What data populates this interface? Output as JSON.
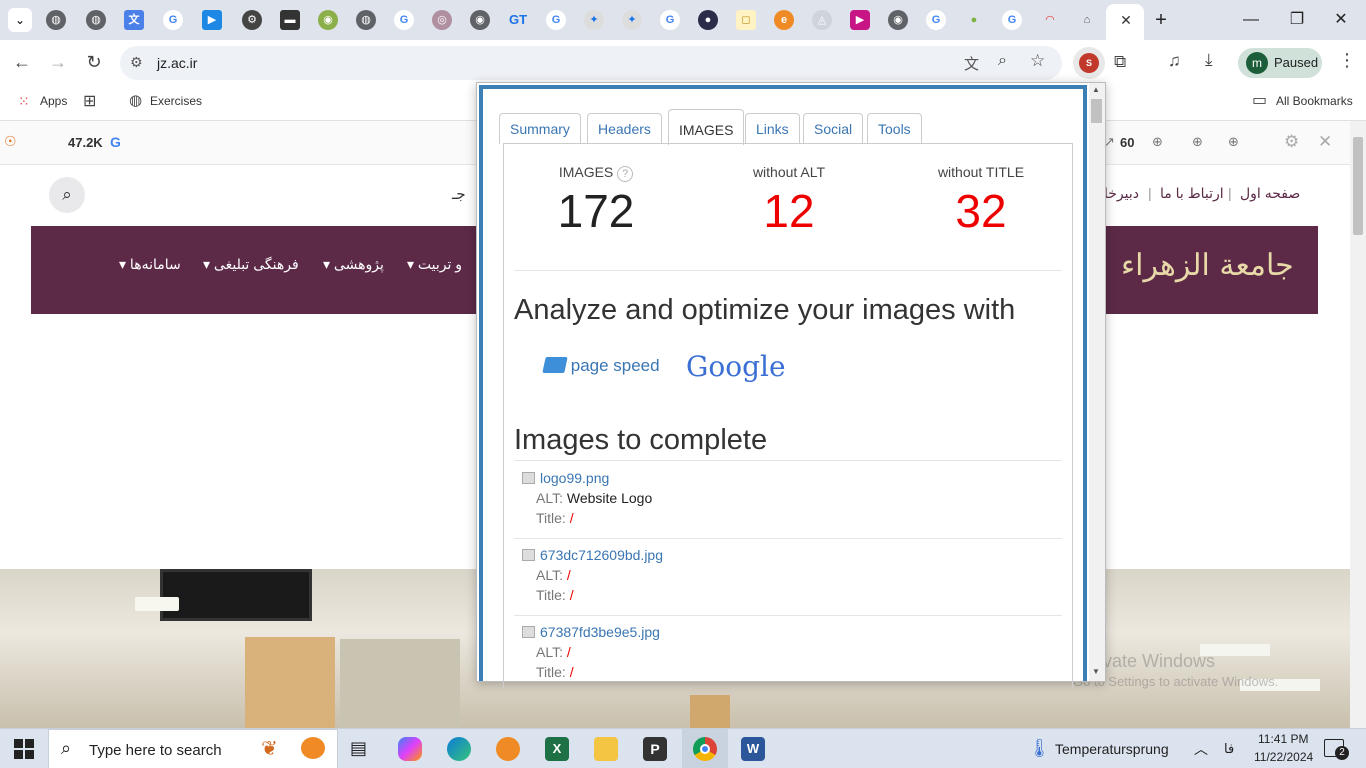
{
  "browser": {
    "address": "jz.ac.ir",
    "profile_initial": "m",
    "profile_status": "Paused",
    "bookmarks": {
      "apps": "Apps",
      "exercises": "Exercises",
      "all": "All Bookmarks"
    },
    "tab_icon_labels": [
      "GT"
    ]
  },
  "seo_bar": {
    "left_count": "47.2K",
    "right_count": "60"
  },
  "site": {
    "header_links": [
      "صفحه اول",
      "ارتباط با ما",
      "دبیرخا"
    ],
    "search_fragment": "جـ",
    "nav_items": [
      "سامانه‌ها",
      "فرهنگی تبلیغی",
      "پژوهشی",
      "و تربیت"
    ],
    "logo_text": "جامعة الزهراء"
  },
  "popup": {
    "tabs": [
      "Summary",
      "Headers",
      "IMAGES",
      "Links",
      "Social",
      "Tools"
    ],
    "active_tab": "IMAGES",
    "stats": {
      "images_label": "IMAGES",
      "images_value": "172",
      "without_alt_label": "without ALT",
      "without_alt_value": "12",
      "without_title_label": "without TITLE",
      "without_title_value": "32"
    },
    "analyze_heading": "Analyze and optimize your images with",
    "page_speed_label": "page speed",
    "google_label": "Google",
    "complete_heading": "Images to complete",
    "alt_label": "ALT:",
    "title_label": "Title:",
    "images": [
      {
        "name": "logo99.png",
        "alt": "Website Logo",
        "title": "/"
      },
      {
        "name": "673dc712609bd.jpg",
        "alt": "/",
        "title": "/"
      },
      {
        "name": "67387fd3be9e5.jpg",
        "alt": "/",
        "title": "/"
      }
    ]
  },
  "watermark": {
    "line1": "Activate Windows",
    "line2": "Go to Settings to activate Windows."
  },
  "taskbar": {
    "search_placeholder": "Type here to search",
    "weather": "Temperatursprung",
    "language": "فا",
    "time": "11:41 PM",
    "date": "11/22/2024",
    "notifications": "2"
  }
}
